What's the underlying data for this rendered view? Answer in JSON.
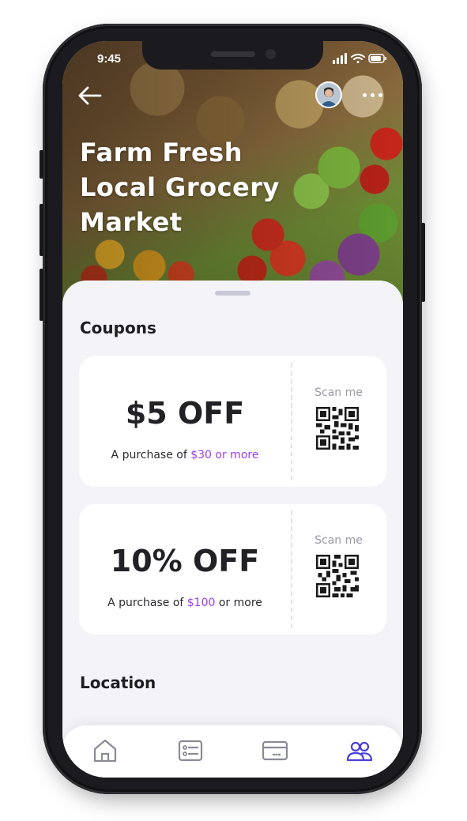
{
  "status_bar": {
    "time": "9:45"
  },
  "hero": {
    "title": "Farm Fresh Local Grocery Market",
    "back_icon": "arrow-left-icon",
    "avatar_icon": "user-avatar",
    "more_icon": "more-horizontal-icon"
  },
  "coupons": {
    "section_title": "Coupons",
    "items": [
      {
        "amount": "$5 OFF",
        "terms_prefix": "A purchase of ",
        "terms_highlight": "$30 or more",
        "terms_suffix": "",
        "scan_label": "Scan me"
      },
      {
        "amount": "10% OFF",
        "terms_prefix": "A purchase of ",
        "terms_highlight": "$100",
        "terms_suffix": " or more",
        "scan_label": "Scan me"
      }
    ]
  },
  "location": {
    "section_title": "Location"
  },
  "tab_bar": {
    "items": [
      {
        "icon": "home-icon",
        "active": false
      },
      {
        "icon": "list-icon",
        "active": false
      },
      {
        "icon": "card-icon",
        "active": false
      },
      {
        "icon": "users-icon",
        "active": true
      }
    ]
  },
  "colors": {
    "accent": "#9b3cf0",
    "active_tab": "#4a3ed6",
    "inactive_tab": "#8a8a96",
    "sheet_background": "#f4f3f7",
    "card_background": "#ffffff"
  }
}
